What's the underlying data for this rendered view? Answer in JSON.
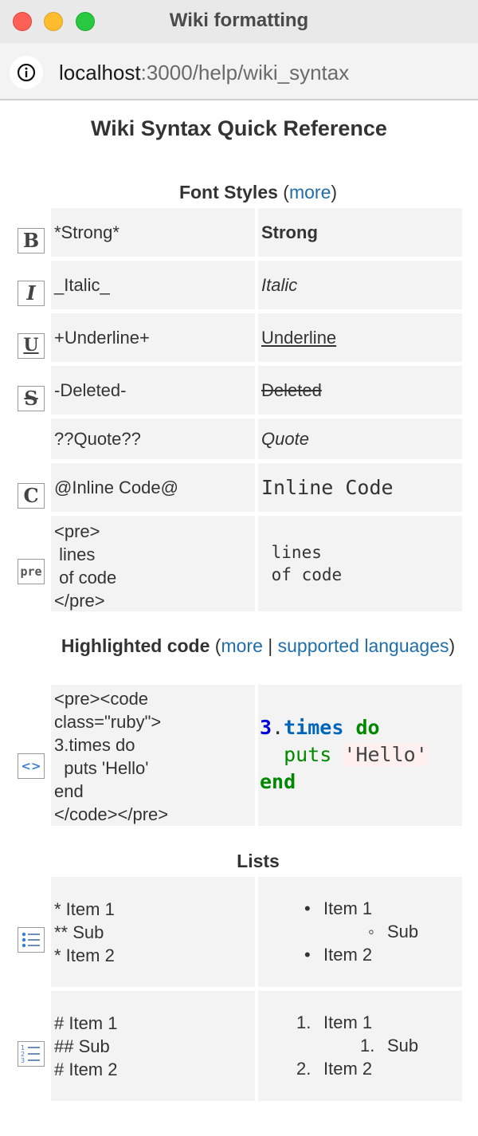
{
  "window": {
    "title": "Wiki formatting"
  },
  "address_bar": {
    "host": "localhost",
    "path": ":3000/help/wiki_syntax"
  },
  "page": {
    "title": "Wiki Syntax Quick Reference",
    "sections": {
      "font_styles": {
        "title": "Font Styles",
        "open": " (",
        "more": "more",
        "close": ")"
      },
      "highlighted": {
        "title": "Highlighted code",
        "open": " (",
        "more": "more",
        "sep": " | ",
        "langs": "supported languages",
        "close": ")"
      },
      "lists": {
        "title": "Lists"
      }
    },
    "rows": {
      "strong": {
        "icon": "bold-icon",
        "syntax": "*Strong*",
        "result": "Strong"
      },
      "italic": {
        "icon": "italic-icon",
        "syntax": "_Italic_",
        "result": "Italic"
      },
      "underline": {
        "icon": "underline-icon",
        "syntax": "+Underline+",
        "result": "Underline"
      },
      "deleted": {
        "icon": "strikethrough-icon",
        "syntax": "-Deleted-",
        "result": "Deleted"
      },
      "quote": {
        "syntax": "??Quote??",
        "result": "Quote"
      },
      "inline_code": {
        "icon": "code-icon",
        "syntax": "@Inline Code@",
        "result": "Inline Code"
      },
      "pre": {
        "icon": "pre-icon",
        "syntax": "<pre>\n lines\n of code\n</pre>",
        "result": " lines\n of code"
      },
      "highlight": {
        "icon": "code-brackets-icon",
        "syntax": "<pre><code\nclass=\"ruby\">\n3.times do\n  puts 'Hello'\nend\n</code></pre>",
        "result": {
          "num": "3",
          "dot": ".",
          "method": "times",
          "kw_do": "do",
          "indent": "  ",
          "puts": "puts",
          "str": "'Hello'",
          "kw_end": "end"
        }
      },
      "ul": {
        "icon": "bullet-list-icon",
        "syntax": "* Item 1\n** Sub\n* Item 2",
        "items": [
          "Item 1",
          "Sub",
          "Item 2"
        ],
        "markers": [
          "•",
          "◦",
          "•"
        ]
      },
      "ol": {
        "icon": "numbered-list-icon",
        "syntax": "# Item 1\n## Sub\n# Item 2",
        "items": [
          "Item 1",
          "Sub",
          "Item 2"
        ],
        "markers": [
          "1.",
          "1.",
          "2."
        ]
      }
    },
    "icon_glyphs": {
      "bold": "B",
      "italic": "I",
      "underline": "U",
      "strike": "S",
      "code": "C",
      "pre": "pre",
      "brackets": "<>"
    }
  },
  "colors": {
    "link": "#1f6ea8",
    "cell_bg": "#f3f3f3"
  }
}
